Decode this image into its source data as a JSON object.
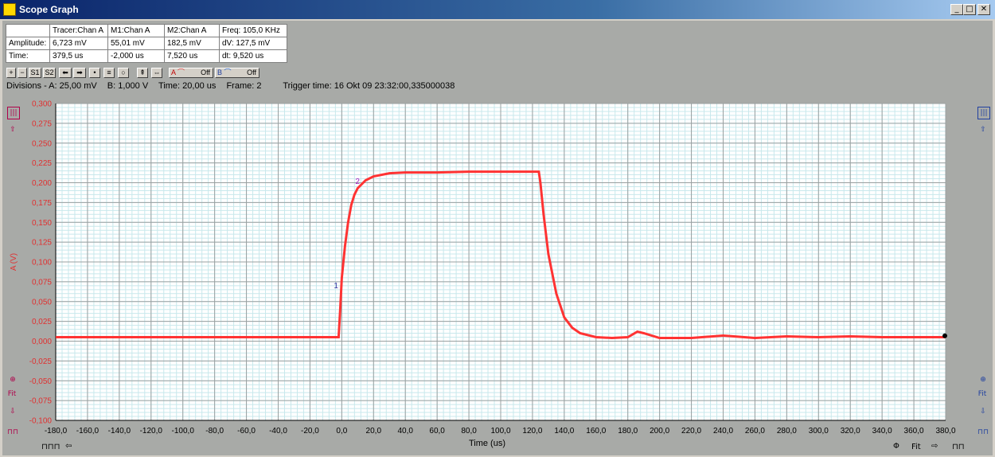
{
  "window": {
    "title": "Scope Graph",
    "btn_min": "_",
    "btn_max": "□",
    "btn_close": "✕"
  },
  "info_table": {
    "headers": [
      "",
      "Tracer:Chan A",
      "M1:Chan A",
      "M2:Chan A",
      "Freq: 105,0 KHz"
    ],
    "rows": [
      [
        "Amplitude:",
        "6,723 mV",
        "55,01 mV",
        "182,5 mV",
        "dV: 127,5 mV"
      ],
      [
        "Time:",
        "379,5 us",
        "-2,000 us",
        "7,520 us",
        "dt: 9,520 us"
      ]
    ]
  },
  "toolbar": {
    "plus": "+",
    "minus": "−",
    "s1": "S1",
    "s2": "S2",
    "left": "⬅",
    "right": "➡",
    "chan_a_label": "A",
    "chan_a_state": "Off",
    "chan_b_label": "B",
    "chan_b_state": "Off"
  },
  "status": {
    "divisions": "Divisions -  A: 25,00 mV",
    "b": "B: 1,000 V",
    "time": "Time: 20,00 us",
    "frame": "Frame: 2",
    "trigger": "Trigger time: 16 Okt 09 23:32:00,335000038"
  },
  "side_icons": {
    "fit": "Fit",
    "fit_bottom": "Fit"
  },
  "markers": {
    "m1": "1",
    "m2": "2"
  },
  "colors": {
    "trace": "#ff3333",
    "grid_major": "#9aa0a0",
    "grid_minor": "#c8e8ec",
    "axis_label": "#e03030"
  },
  "chart_data": {
    "type": "line",
    "xlabel": "Time (us)",
    "ylabel": "A (V)",
    "xlim": [
      -180,
      380
    ],
    "ylim": [
      -0.1,
      0.3
    ],
    "x_ticks": [
      "-180,0",
      "-160,0",
      "-140,0",
      "-120,0",
      "-100,0",
      "-80,0",
      "-60,0",
      "-40,0",
      "-20,0",
      "0,0",
      "20,0",
      "40,0",
      "60,0",
      "80,0",
      "100,0",
      "120,0",
      "140,0",
      "160,0",
      "180,0",
      "200,0",
      "220,0",
      "240,0",
      "260,0",
      "280,0",
      "300,0",
      "320,0",
      "340,0",
      "360,0",
      "380,0"
    ],
    "y_ticks": [
      "0,300",
      "0,275",
      "0,250",
      "0,225",
      "0,200",
      "0,175",
      "0,150",
      "0,125",
      "0,100",
      "0,075",
      "0,050",
      "0,025",
      "0,000",
      "-0,025",
      "-0,050",
      "-0,075",
      "-0,100"
    ],
    "grid": true,
    "series": [
      {
        "x": [
          -180,
          -100,
          -2,
          -1,
          0,
          2,
          4,
          6,
          8,
          10,
          15,
          20,
          30,
          40,
          60,
          80,
          100,
          124,
          125,
          127,
          130,
          135,
          140,
          145,
          150,
          160,
          170,
          180,
          186,
          190,
          200,
          220,
          240,
          260,
          280,
          300,
          320,
          340,
          360,
          380
        ],
        "y": [
          0.005,
          0.005,
          0.005,
          0.04,
          0.08,
          0.12,
          0.15,
          0.172,
          0.185,
          0.193,
          0.203,
          0.208,
          0.212,
          0.213,
          0.213,
          0.214,
          0.214,
          0.214,
          0.2,
          0.16,
          0.11,
          0.06,
          0.03,
          0.017,
          0.01,
          0.005,
          0.004,
          0.005,
          0.012,
          0.01,
          0.004,
          0.004,
          0.007,
          0.004,
          0.006,
          0.005,
          0.006,
          0.005,
          0.005,
          0.005
        ]
      }
    ]
  }
}
